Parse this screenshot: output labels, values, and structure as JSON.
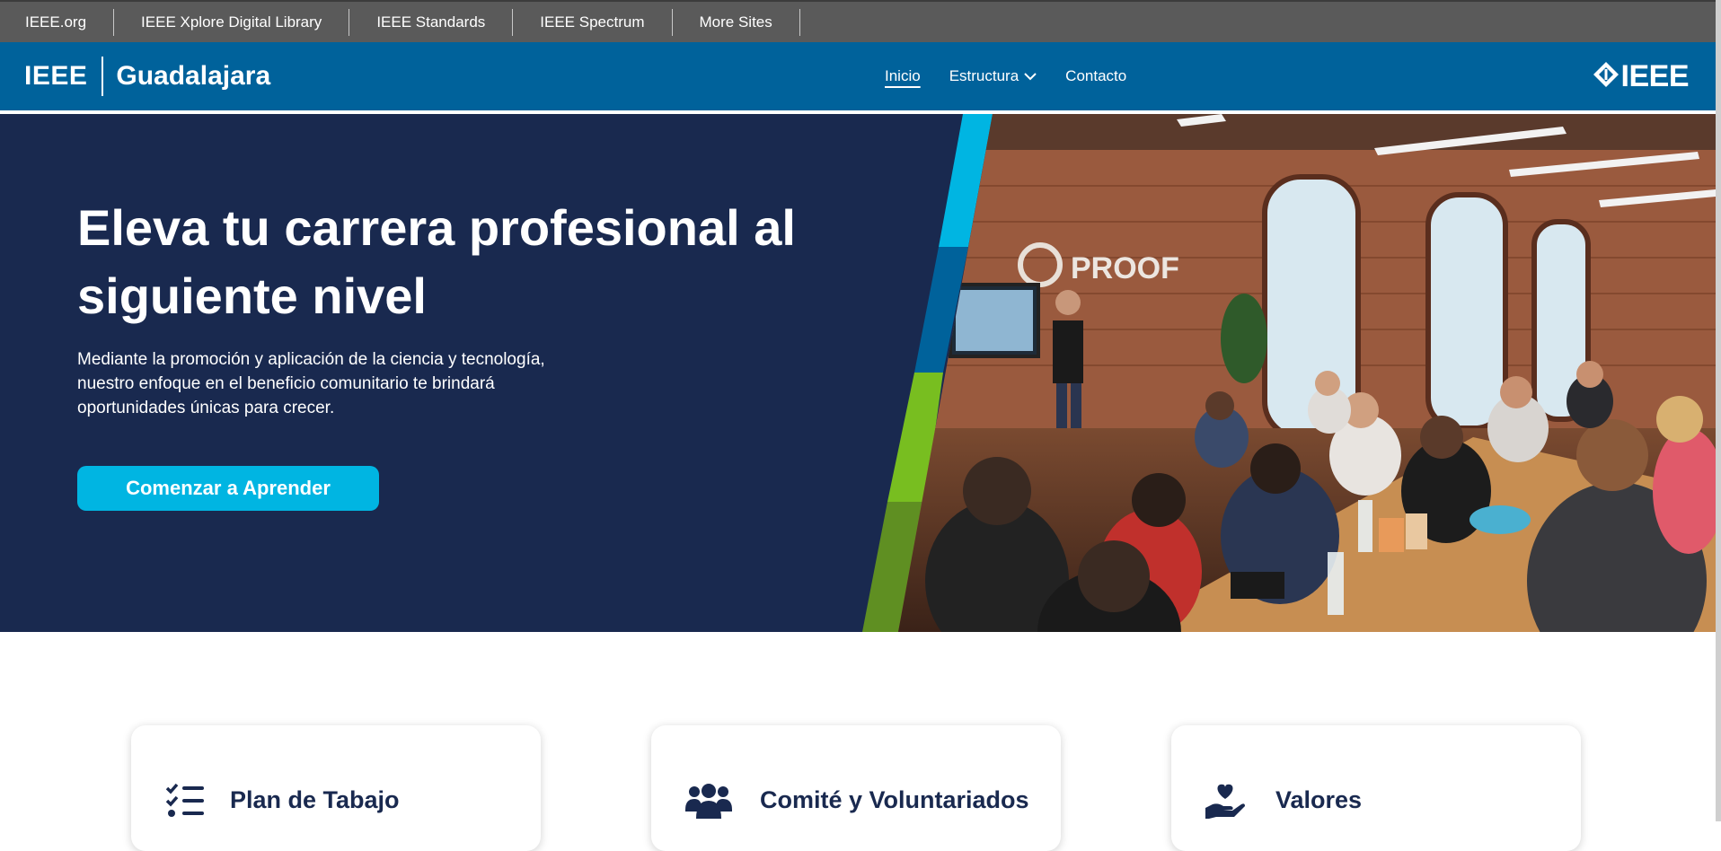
{
  "meta_links": [
    "IEEE.org",
    "IEEE Xplore Digital Library",
    "IEEE Standards",
    "IEEE Spectrum",
    "More Sites"
  ],
  "header": {
    "brand_left": "IEEE",
    "brand_right": "Guadalajara",
    "logo_text": "IEEE",
    "nav": [
      {
        "label": "Inicio",
        "active": true
      },
      {
        "label": "Estructura",
        "has_dropdown": true
      },
      {
        "label": "Contacto"
      }
    ]
  },
  "hero": {
    "title": "Eleva tu carrera profesional al siguiente nivel",
    "description": "Mediante la promoción y aplicación de la ciencia y tecnología, nuestro enfoque en el beneficio comunitario te brindará oportunidades únicas para crecer.",
    "cta": "Comenzar a Aprender",
    "photo_sign": "PROOF"
  },
  "cards": [
    {
      "title": "Plan de Tabajo",
      "icon": "checklist-icon"
    },
    {
      "title": "Comité y Voluntariados",
      "icon": "users-icon"
    },
    {
      "title": "Valores",
      "icon": "heart-hand-icon"
    }
  ],
  "colors": {
    "meta_bar": "#5a5a5a",
    "header": "#00629b",
    "hero_bg": "#19294f",
    "accent_cyan": "#00b5e2",
    "accent_green": "#78be20"
  }
}
